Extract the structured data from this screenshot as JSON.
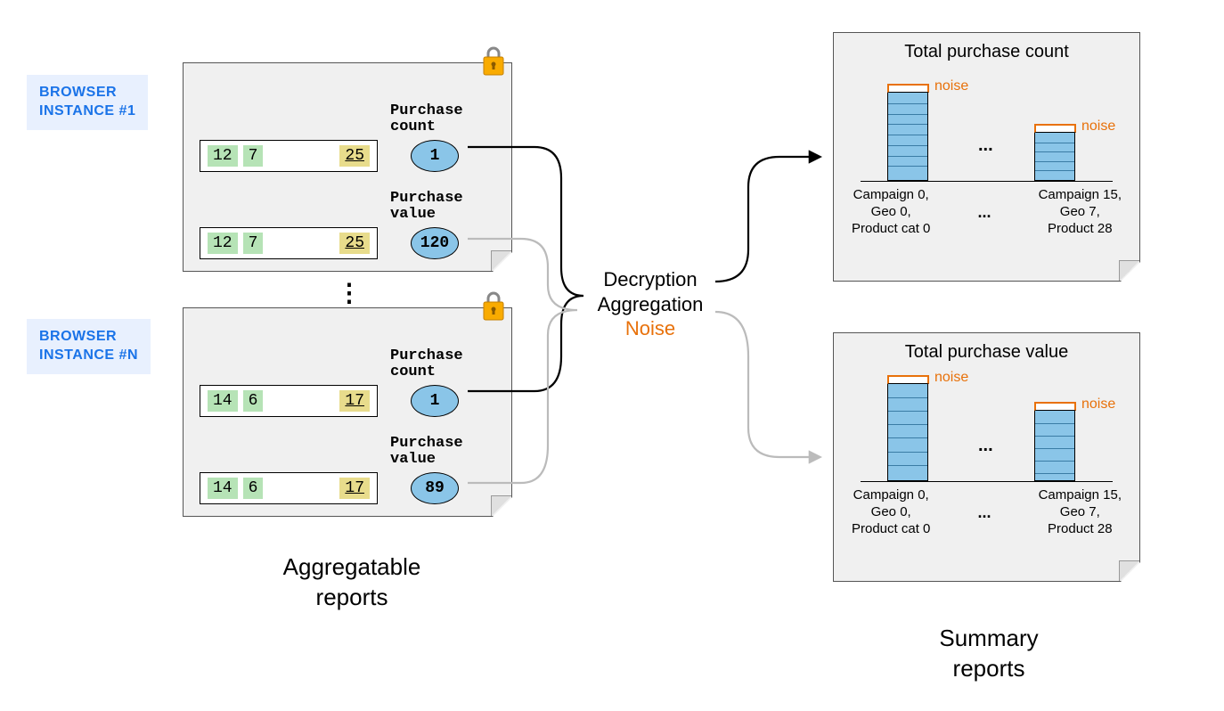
{
  "browser_labels": {
    "b1_line1": "BROWSER",
    "b1_line2": "INSTANCE #1",
    "bn_line1": "BROWSER",
    "bn_line2": "INSTANCE #N"
  },
  "reports": {
    "r1": {
      "keys": [
        "12",
        "7",
        "25"
      ],
      "metrics": {
        "count_label_l1": "Purchase",
        "count_label_l2": "count",
        "count_value": "1",
        "value_label_l1": "Purchase",
        "value_label_l2": "value",
        "value_value": "120"
      }
    },
    "rn": {
      "keys": [
        "14",
        "6",
        "17"
      ],
      "metrics": {
        "count_label_l1": "Purchase",
        "count_label_l2": "count",
        "count_value": "1",
        "value_label_l1": "Purchase",
        "value_label_l2": "value",
        "value_value": "89"
      }
    }
  },
  "center": {
    "line1": "Decryption",
    "line2": "Aggregation",
    "line3": "Noise"
  },
  "summary": {
    "count_title": "Total purchase count",
    "value_title": "Total purchase value",
    "noise": "noise",
    "cat1_l1": "Campaign 0,",
    "cat1_l2": "Geo 0,",
    "cat1_l3": "Product cat 0",
    "cat2_l1": "Campaign 15,",
    "cat2_l2": "Geo 7,",
    "cat2_l3": "Product 28",
    "dots": "..."
  },
  "section_labels": {
    "left_l1": "Aggregatable",
    "left_l2": "reports",
    "right_l1": "Summary",
    "right_l2": "reports"
  },
  "chart_data": [
    {
      "type": "bar",
      "title": "Total purchase count",
      "categories": [
        "Campaign 0, Geo 0, Product cat 0",
        "...",
        "Campaign 15, Geo 7, Product 28"
      ],
      "values_relative": [
        100,
        null,
        55
      ],
      "noise_overlay": true,
      "note": "relative bar heights estimated from figure; no numeric axis shown"
    },
    {
      "type": "bar",
      "title": "Total purchase value",
      "categories": [
        "Campaign 0, Geo 0, Product cat 0",
        "...",
        "Campaign 15, Geo 7, Product 28"
      ],
      "values_relative": [
        100,
        null,
        72
      ],
      "noise_overlay": true,
      "note": "relative bar heights estimated from figure; no numeric axis shown"
    }
  ]
}
